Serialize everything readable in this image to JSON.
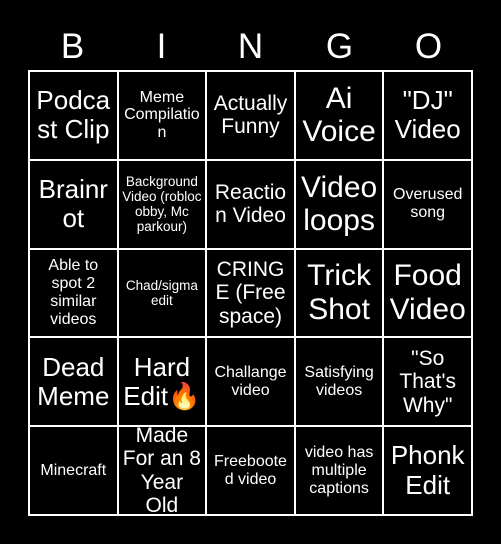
{
  "card": {
    "background_color": "#000000",
    "text_color": "#ffffff",
    "grid_line_color": "#ffffff",
    "header": {
      "letters": [
        "B",
        "I",
        "N",
        "G",
        "O"
      ]
    },
    "rows": [
      [
        {
          "text": "Podcast Clip",
          "size": "lg"
        },
        {
          "text": "Meme Compilation",
          "size": "sm"
        },
        {
          "text": "Actually Funny",
          "size": "md"
        },
        {
          "text": "Ai Voice",
          "size": "xl"
        },
        {
          "text": "\"DJ\" Video",
          "size": "lg"
        }
      ],
      [
        {
          "text": "Brainrot",
          "size": "lg"
        },
        {
          "text": "Background Video (robloc obby, Mc parkour)",
          "size": "xs"
        },
        {
          "text": "Reaction Video",
          "size": "md"
        },
        {
          "text": "Video loops",
          "size": "xl"
        },
        {
          "text": "Overused song",
          "size": "sm"
        }
      ],
      [
        {
          "text": "Able to spot 2 similar videos",
          "size": "sm"
        },
        {
          "text": "Chad/sigma edit",
          "size": "xs"
        },
        {
          "text": "CRINGE (Free space)",
          "size": "md"
        },
        {
          "text": "Trick Shot",
          "size": "xl"
        },
        {
          "text": "Food Video",
          "size": "xl"
        }
      ],
      [
        {
          "text": "Dead Meme",
          "size": "lg"
        },
        {
          "text": "Hard Edit🔥",
          "size": "lg"
        },
        {
          "text": "Challange video",
          "size": "sm"
        },
        {
          "text": "Satisfying videos",
          "size": "sm"
        },
        {
          "text": "\"So That's Why\"",
          "size": "md"
        }
      ],
      [
        {
          "text": "Minecraft",
          "size": "sm"
        },
        {
          "text": "Made For an 8 Year Old",
          "size": "md"
        },
        {
          "text": "Freebooted video",
          "size": "sm"
        },
        {
          "text": "video has multiple captions",
          "size": "sm"
        },
        {
          "text": "Phonk Edit",
          "size": "lg"
        }
      ]
    ]
  }
}
